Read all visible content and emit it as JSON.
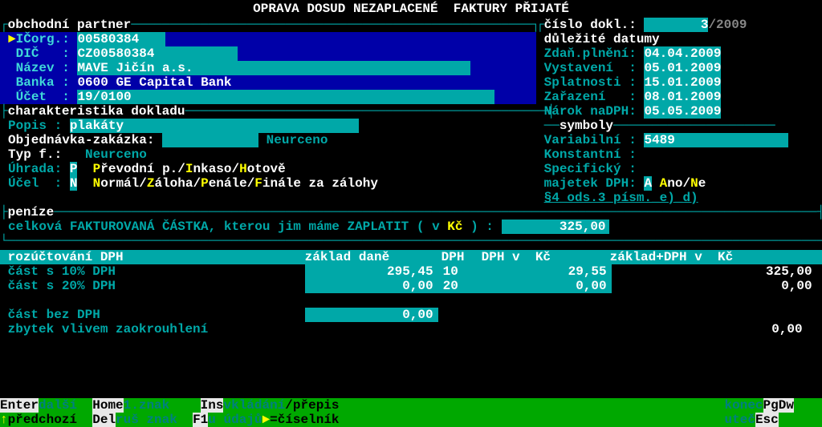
{
  "title": "OPRAVA DOSUD NEZAPLACENÉ  FAKTURY PŘIJATÉ",
  "sections": {
    "partner_header": "obchodní partner",
    "char_header": "charakteristika dokladu",
    "money_header": "peníze",
    "dates_header": "důležité datumy",
    "symbols_header": "symboly"
  },
  "doc": {
    "label": "číslo dokl.:",
    "num": "3",
    "year": "/2009"
  },
  "partner": {
    "icorg_l": "IČorg.:",
    "icorg": "00580384",
    "dic_l": "DIČ   :",
    "dic": "CZ00580384",
    "nazev_l": "Název :",
    "nazev": "MAVE Jičín a.s.",
    "banka_l": "Banka :",
    "banka": "0600 GE Capital Bank",
    "ucet_l": "Účet  :",
    "ucet": "19/0100"
  },
  "dates": {
    "zdan_l": "Zdaň.plnění:",
    "zdan": "04.04.2009",
    "vyst_l": "Vystavení  :",
    "vyst": "05.01.2009",
    "splat_l": "Splatnosti :",
    "splat": "15.01.2009",
    "zaraz_l": "Zařazení   :",
    "zaraz": "08.01.2009",
    "narok_l": "Nárok naDPH:",
    "narok": "05.05.2009"
  },
  "char": {
    "popis_l": "Popis :",
    "popis": "plakáty",
    "obj_l": "Objednávka-zakázka:",
    "obj": "Neurceno",
    "typ_l": "Typ f.:",
    "typ": "Neurceno",
    "uhrada_l": "Úhrada:",
    "uhrada_v": "P",
    "uhrada_opts_p": "P",
    "uhrada_opts_rest": "řevodní p./",
    "uhrada_i": "I",
    "uhrada_i_rest": "nkaso/",
    "uhrada_h": "H",
    "uhrada_h_rest": "otově",
    "ucel_l": "Účel  :",
    "ucel_v": "N",
    "ucel_n": "N",
    "ucel_n_rest": "ormál/",
    "ucel_z": "Z",
    "ucel_z_rest": "áloha/",
    "ucel_p": "P",
    "ucel_p_rest": "enále/",
    "ucel_f": "F",
    "ucel_f_rest": "inále za zálohy"
  },
  "symbols": {
    "var_l": "Variabilní :",
    "var": "5489",
    "kon_l": "Konstantní :",
    "kon": "",
    "spec_l": "Specifický :",
    "spec": "",
    "maj_l": "majetek DPH:",
    "maj_v": "A",
    "maj_a": "A",
    "maj_a_rest": "no/",
    "maj_n": "N",
    "maj_n_rest": "e",
    "par_link": "§4_ods.3_písm._e)_d)"
  },
  "total": {
    "label1": "celková FAKTUROVANÁ ČÁSTKA, kterou jim máme ZAPLATIT ( v ",
    "currency": "Kč",
    "label2": " ) :",
    "value": "325,00"
  },
  "dph": {
    "header_l": "rozúčtování DPH",
    "h_base": "základ daně",
    "h_dph": "DPH",
    "h_dphkc": "DPH v  Kč",
    "h_total": "základ+DPH v  Kč",
    "r1_l": "část s 10% DPH",
    "r1_base": "295,45",
    "r1_rate": "10",
    "r1_dph": "29,55",
    "r1_tot": "325,00",
    "r2_l": "část s 20% DPH",
    "r2_base": "0,00",
    "r2_rate": "20",
    "r2_dph": "0,00",
    "r2_tot": "0,00",
    "r3_l": "část bez DPH",
    "r3_base": "0,00",
    "r4_l": "zbytek vlivem zaokrouhlení",
    "r4_tot": "0,00"
  },
  "footer": {
    "enter": "Enter",
    "enter_t": "další ",
    "home": "Home",
    "home_t": "1.znak ",
    "ins": "Ins",
    "ins_t": "vkládání",
    "ins_t2": "/přepis",
    "konec": "konec",
    "pgdw": "PgDw",
    "up": "↑",
    "up_t": "předchozí ",
    "del": "Del",
    "del_t": "ruš znak ",
    "f1": "F1",
    "f1_t": "u údajů",
    "f1_t2": "=číselník",
    "utec": "uteč",
    "esc": "Esc"
  }
}
